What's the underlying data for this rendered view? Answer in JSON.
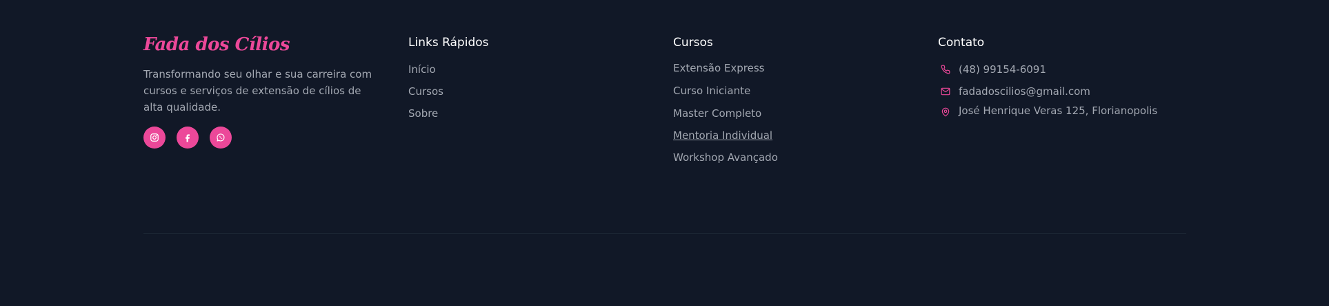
{
  "brand": {
    "name": "Fada dos Cílios",
    "description": "Transformando seu olhar e sua carreira com cursos e serviços de extensão de cílios de alta qualidade.",
    "social": [
      {
        "icon": "instagram-icon"
      },
      {
        "icon": "facebook-icon"
      },
      {
        "icon": "whatsapp-icon"
      }
    ]
  },
  "quick_links": {
    "title": "Links Rápidos",
    "items": [
      "Início",
      "Cursos",
      "Sobre"
    ]
  },
  "courses": {
    "title": "Cursos",
    "items": [
      "Extensão Express",
      "Curso Iniciante",
      "Master Completo",
      "Mentoria Individual",
      "Workshop Avançado"
    ]
  },
  "contact": {
    "title": "Contato",
    "phone": "(48) 99154-6091",
    "email": "fadadoscilios@gmail.com",
    "address": "José Henrique Veras 125, Florianopolis"
  },
  "colors": {
    "background": "#111827",
    "accent": "#ec4899",
    "heading": "#ffffff",
    "text": "#a3a8b2"
  }
}
